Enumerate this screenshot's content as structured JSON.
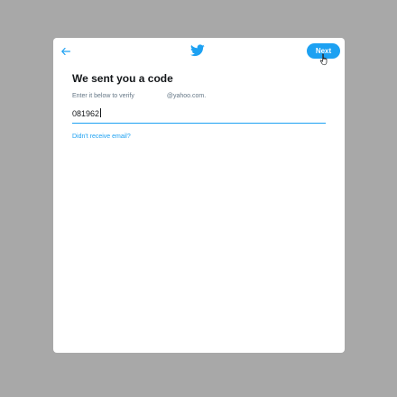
{
  "header": {
    "back_icon": "arrow-left-icon",
    "logo_icon": "twitter-bird-icon",
    "next_label": "Next"
  },
  "main": {
    "title": "We sent you a code",
    "instruction_prefix": "Enter it below to verify",
    "email_suffix": "@yahoo.com.",
    "code_value": "081962",
    "resend_link": "Didn't receive email?"
  },
  "colors": {
    "accent": "#1da1f2",
    "backdrop": "#a8a8a8",
    "text": "#14171a",
    "secondary_text": "#657786"
  }
}
